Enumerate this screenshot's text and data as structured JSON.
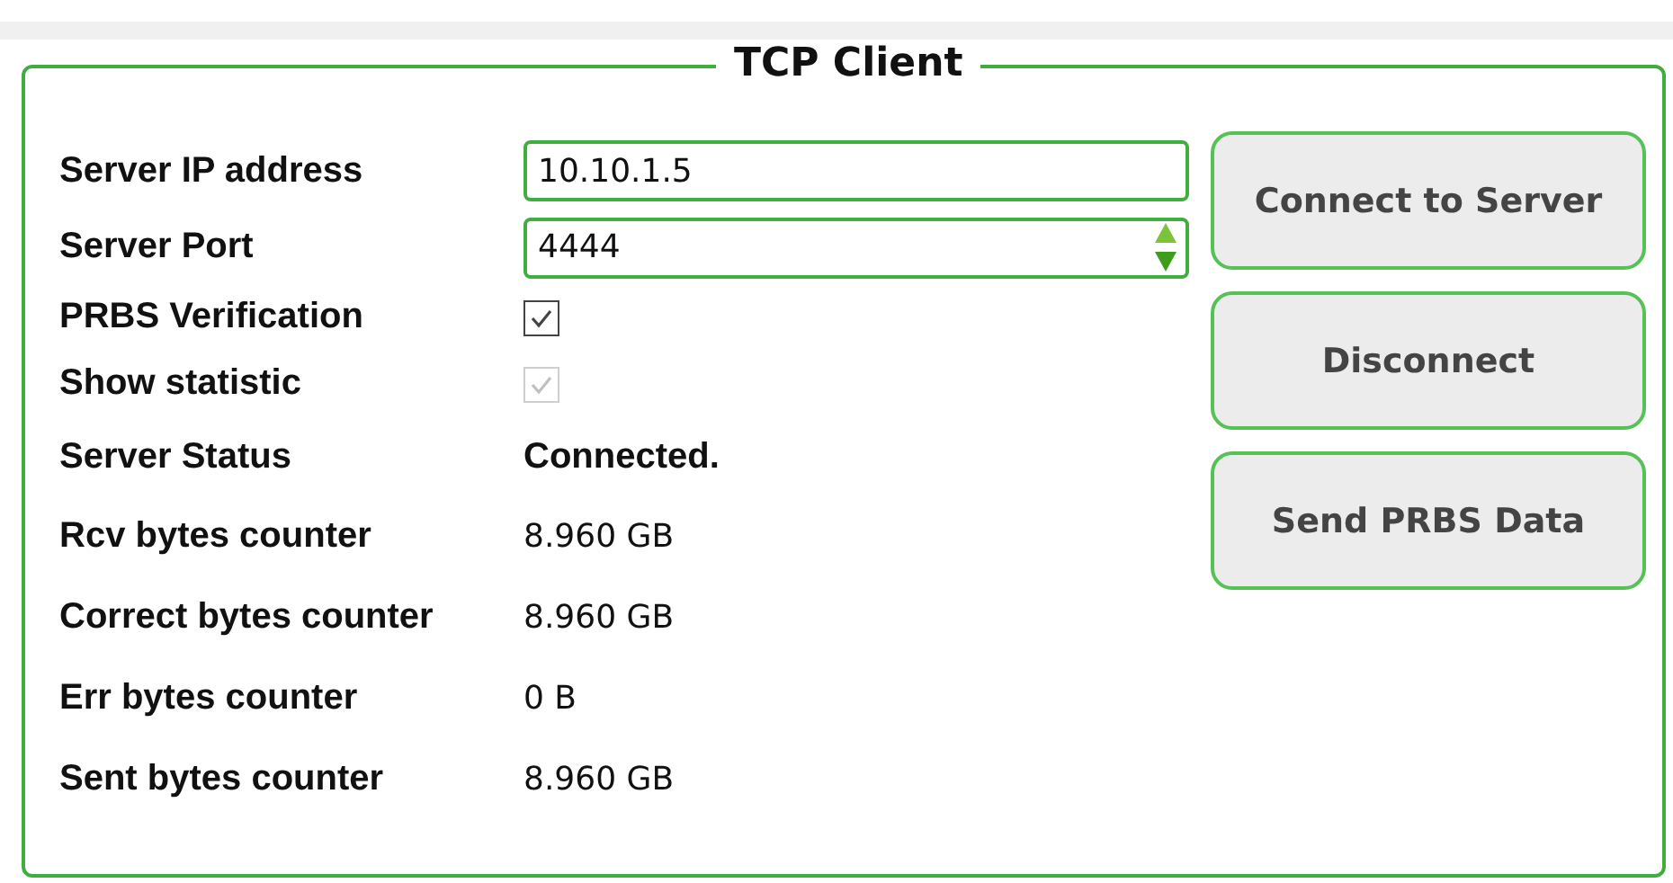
{
  "group": {
    "title": "TCP Client"
  },
  "rows": [
    {
      "kind": "text",
      "label": "Server IP address",
      "value": "10.10.1.5"
    },
    {
      "kind": "spin",
      "label": "Server Port",
      "value": "4444"
    },
    {
      "kind": "checkbox",
      "label": "PRBS Verification",
      "checked": true,
      "disabled": false
    },
    {
      "kind": "checkbox",
      "label": "Show statistic",
      "checked": true,
      "disabled": true
    },
    {
      "kind": "status",
      "label": "Server Status",
      "value": "Connected."
    },
    {
      "kind": "value",
      "label": "Rcv bytes counter",
      "value": "8.960 GB"
    },
    {
      "kind": "value",
      "label": "Correct bytes counter",
      "value": "8.960 GB"
    },
    {
      "kind": "value",
      "label": "Err bytes counter",
      "value": "0 B"
    },
    {
      "kind": "value",
      "label": "Sent bytes counter",
      "value": "8.960 GB"
    }
  ],
  "buttons": [
    "Connect to Server",
    "Disconnect",
    "Send PRBS Data"
  ]
}
